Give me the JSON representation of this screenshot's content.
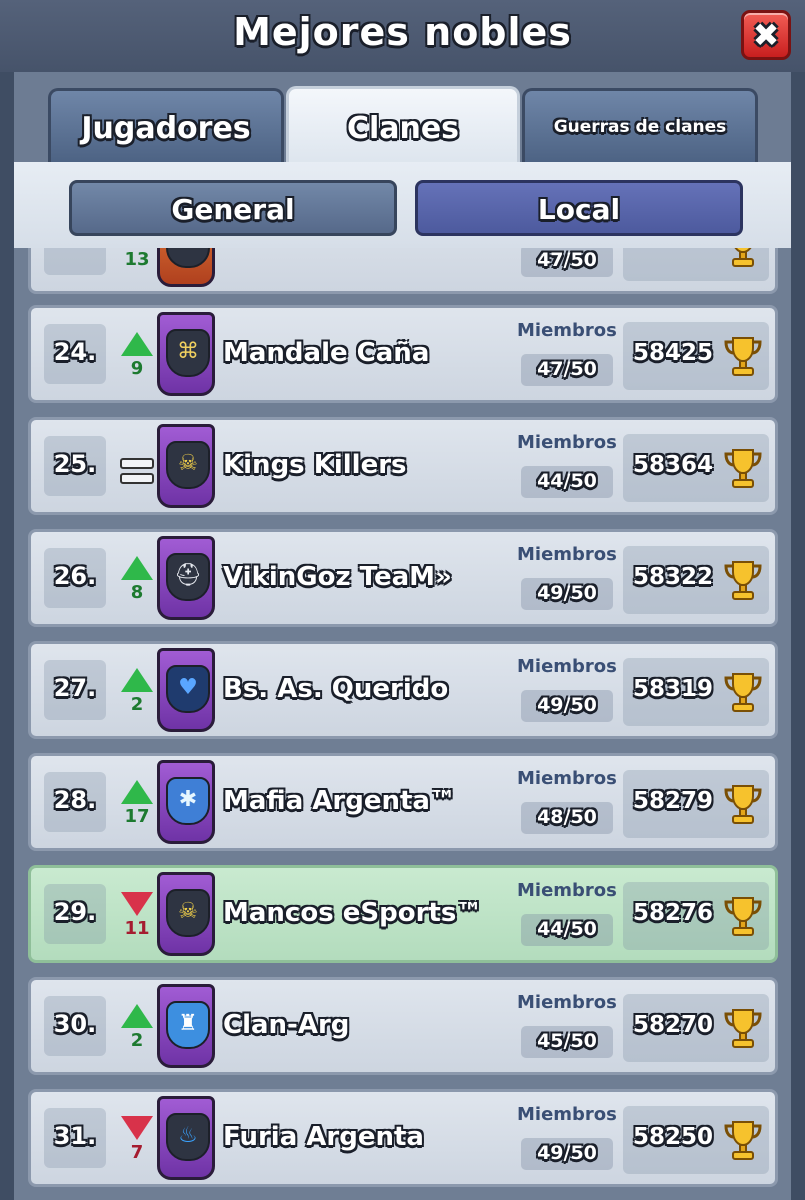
{
  "header": {
    "title": "Mejores nobles",
    "close_label": "✖"
  },
  "tabs": [
    {
      "label": "Jugadores",
      "active": false
    },
    {
      "label": "Clanes",
      "active": true
    },
    {
      "label": "Guerras de clanes",
      "active": false
    }
  ],
  "filters": {
    "general_label": "General",
    "local_label": "Local",
    "selected": "Local"
  },
  "partial_row": {
    "change": "13",
    "members": "47/50"
  },
  "rows": [
    {
      "rank": "24.",
      "change": "9",
      "direction": "up",
      "badge_icon": "bamboo-icon",
      "name": "Mandale Caña",
      "members_label": "Miembros",
      "members": "47/50",
      "trophies": "58425",
      "highlight": false
    },
    {
      "rank": "25.",
      "change": "",
      "direction": "same",
      "badge_icon": "skull-icon",
      "name": "Kings Killers",
      "members_label": "Miembros",
      "members": "44/50",
      "trophies": "58364",
      "highlight": false
    },
    {
      "rank": "26.",
      "change": "8",
      "direction": "up",
      "badge_icon": "helmet-icon",
      "name": "VikinGoz TeaM»",
      "members_label": "Miembros",
      "members": "49/50",
      "trophies": "58322",
      "highlight": false
    },
    {
      "rank": "27.",
      "change": "2",
      "direction": "up",
      "badge_icon": "heart-icon",
      "name": "Bs. As. Querido",
      "members_label": "Miembros",
      "members": "49/50",
      "trophies": "58319",
      "highlight": false
    },
    {
      "rank": "28.",
      "change": "17",
      "direction": "up",
      "badge_icon": "star-icon",
      "name": "Mafia Argenta™",
      "members_label": "Miembros",
      "members": "48/50",
      "trophies": "58279",
      "highlight": false
    },
    {
      "rank": "29.",
      "change": "11",
      "direction": "down",
      "badge_icon": "skull-icon",
      "name": "Mancos eSports™",
      "members_label": "Miembros",
      "members": "44/50",
      "trophies": "58276",
      "highlight": true
    },
    {
      "rank": "30.",
      "change": "2",
      "direction": "up",
      "badge_icon": "tower-icon",
      "name": "Clan-Arg",
      "members_label": "Miembros",
      "members": "45/50",
      "trophies": "58270",
      "highlight": false
    },
    {
      "rank": "31.",
      "change": "7",
      "direction": "down",
      "badge_icon": "flame-icon",
      "name": "Furia Argenta",
      "members_label": "Miembros",
      "members": "49/50",
      "trophies": "58250",
      "highlight": false
    }
  ],
  "colors": {
    "up": "#2fb84a",
    "down": "#d8324a",
    "highlight_row": "#b3dcbd",
    "badge_purple": "#8a45c2",
    "local_button": "#5764aa"
  }
}
